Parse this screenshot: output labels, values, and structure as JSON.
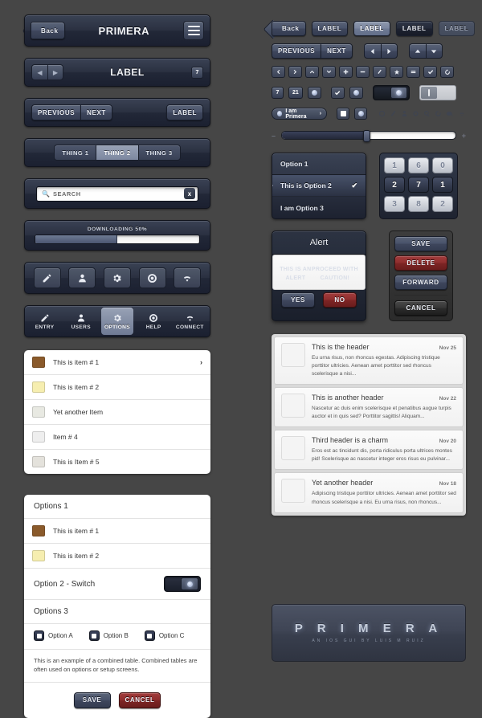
{
  "nav": {
    "back_label": "Back",
    "app_title": "PRIMERA",
    "menu_icon": "hamburger-icon",
    "label_title": "LABEL",
    "badge_count": "7"
  },
  "toolbar": {
    "previous_label": "PREVIOUS",
    "next_label": "NEXT",
    "label_button": "LABEL"
  },
  "segmented": {
    "items": [
      {
        "label": "THING 1",
        "selected": false
      },
      {
        "label": "THING 2",
        "selected": true
      },
      {
        "label": "THING 3",
        "selected": false
      }
    ]
  },
  "search": {
    "placeholder": "SEARCH",
    "value": "",
    "icon": "search-icon",
    "clear_label": "x"
  },
  "progress": {
    "label": "DOWNLOADING 50%",
    "percent": 50
  },
  "icon_toolbar": {
    "items": [
      {
        "icon": "pencil-icon"
      },
      {
        "icon": "user-icon"
      },
      {
        "icon": "gear-icon"
      },
      {
        "icon": "lifebuoy-icon"
      },
      {
        "icon": "wifi-icon"
      }
    ]
  },
  "tabbar": {
    "items": [
      {
        "label": "ENTRY",
        "icon": "pencil-icon",
        "selected": false
      },
      {
        "label": "USERS",
        "icon": "user-icon",
        "selected": false
      },
      {
        "label": "OPTIONS",
        "icon": "gear-icon",
        "selected": true
      },
      {
        "label": "HELP",
        "icon": "lifebuoy-icon",
        "selected": false
      },
      {
        "label": "CONNECT",
        "icon": "wifi-icon",
        "selected": false
      }
    ]
  },
  "item_list": {
    "rows": [
      {
        "label": "This is item # 1",
        "color": "#8a5a2b",
        "chevron": "›"
      },
      {
        "label": "This is item # 2",
        "color": "#f6eeb0",
        "chevron": ""
      },
      {
        "label": "Yet another Item",
        "color": "#e8e9e2",
        "chevron": ""
      },
      {
        "label": "Item # 4",
        "color": "#eeeeee",
        "chevron": ""
      },
      {
        "label": "This is Item # 5",
        "color": "#e4e2dc",
        "chevron": ""
      }
    ]
  },
  "options_table": {
    "section1_title": "Options 1",
    "rows": [
      {
        "label": "This is item # 1",
        "color": "#8a5a2b"
      },
      {
        "label": "This is item # 2",
        "color": "#f6eeb0"
      }
    ],
    "switch_row_label": "Option 2 - Switch",
    "switch_on": true,
    "section3_title": "Options 3",
    "checkboxes": [
      {
        "label": "Option A",
        "checked": true
      },
      {
        "label": "Option B",
        "checked": true
      },
      {
        "label": "Option C",
        "checked": true
      }
    ],
    "note": "This is an example of a combined table. Combined tables are often used on options or setup screens.",
    "save_label": "SAVE",
    "cancel_label": "CANCEL"
  },
  "right": {
    "button_row": {
      "back_label": "Back",
      "labels": [
        {
          "label": "LABEL",
          "state": "normal"
        },
        {
          "label": "LABEL",
          "state": "light"
        },
        {
          "label": "LABEL",
          "state": "dark"
        },
        {
          "label": "LABEL",
          "state": "disabled"
        }
      ]
    },
    "nav_row": {
      "previous_label": "PREVIOUS",
      "next_label": "NEXT",
      "arrows": [
        "left-arrow-icon",
        "right-arrow-icon",
        "up-arrow-icon",
        "down-arrow-icon"
      ]
    },
    "icon_row": [
      "chevron-left-icon",
      "chevron-right-icon",
      "chevron-up-icon",
      "chevron-down-icon",
      "plus-icon",
      "minus-icon",
      "pencil-icon",
      "star-icon",
      "equals-icon",
      "check-icon",
      "refresh-icon"
    ],
    "badge_row": {
      "badge_7": "7",
      "badge_21": "21",
      "dot_icon": "glow-dot-icon",
      "check_icon": "check-icon",
      "round_dot_icon": "glow-dot-icon"
    },
    "pill": {
      "label": "I am Primera",
      "chevron": "›",
      "dot_icon": "glow-dot-icon"
    },
    "toggles": {
      "dark_on": true,
      "light_off": true
    },
    "tiny_icons": [
      "circle-icon",
      "pencil-icon",
      "user-icon",
      "gear-icon",
      "search-icon",
      "refresh-icon",
      "tag-icon",
      "wifi-icon"
    ],
    "slider": {
      "minus_label": "–",
      "plus_label": "+",
      "value": 50
    },
    "picker": {
      "options": [
        {
          "label": "Option 1",
          "selected": false
        },
        {
          "label": "This is Option 2",
          "selected": true
        },
        {
          "label": "I am Option 3",
          "selected": false
        }
      ],
      "check_glyph": "✔"
    },
    "keypad": {
      "rows": [
        [
          {
            "key": "1",
            "hi": false
          },
          {
            "key": "6",
            "hi": false
          },
          {
            "key": "0",
            "hi": false
          }
        ],
        [
          {
            "key": "2",
            "hi": true
          },
          {
            "key": "7",
            "hi": true
          },
          {
            "key": "1",
            "hi": true
          }
        ],
        [
          {
            "key": "3",
            "hi": false
          },
          {
            "key": "8",
            "hi": false
          },
          {
            "key": "2",
            "hi": false
          }
        ]
      ]
    },
    "alert": {
      "title": "Alert",
      "message": "THIS IS AN ALERT\nPROCEED WITH CAUTION!",
      "yes_label": "YES",
      "no_label": "NO"
    },
    "action_sheet": {
      "save_label": "SAVE",
      "delete_label": "DELETE",
      "forward_label": "FORWARD",
      "cancel_label": "CANCEL"
    },
    "messages": [
      {
        "title": "This is the header",
        "date": "Nov 25",
        "text": "Eu urna risus, non rhoncus egestas. Adipiscing tristique porttitor ultricies. Aenean amet porttitor sed rhoncus scelerisque a nisi..."
      },
      {
        "title": "This is another header",
        "date": "Nov 22",
        "text": "Nascetur ac duis enim scelerisque et penatibus augue turpis auctor et in quis sed? Porttitor sagittis! Aliquam..."
      },
      {
        "title": "Third header is a charm",
        "date": "Nov 20",
        "text": "Eros est ac tincidunt dis, porta ridiculus porta ultrices montes pid! Scelerisque ac nascetur integer eros risus eu pulvinar..."
      },
      {
        "title": "Yet another header",
        "date": "Nov 18",
        "text": "Adipiscing tristique porttitor ultricies. Aenean amet porttitor sed rhoncus scelerisque a nisi. Eu urna risus, non rhoncus..."
      }
    ],
    "logo": {
      "name": "P R I M E R A",
      "tagline": "AN IOS GUI BY LUIS M RUIZ"
    }
  },
  "colors": {
    "background": "#464646",
    "panel_dark": "#2a3040",
    "accent_blue": "#7d88a0",
    "danger_red": "#8e2e2e"
  }
}
